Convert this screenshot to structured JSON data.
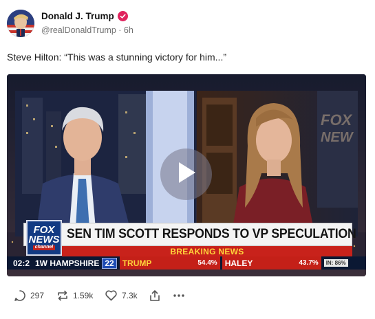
{
  "post": {
    "display_name": "Donald J. Trump",
    "handle_time": "@realDonaldTrump · 6h",
    "text": "Steve Hilton: “This was a stunning victory for him...”"
  },
  "video": {
    "fox_logo": {
      "line1": "FOX",
      "line2": "NEWS",
      "line3": "channel"
    },
    "chyron": "SEN TIM SCOTT RESPONDS TO VP SPECULATION",
    "breaking": "BREAKING NEWS",
    "ticker": {
      "time": "02:2",
      "state": "1W HAMPSHIRE",
      "pct_reported": "22",
      "trump_name": "TRUMP",
      "trump_pct": "54.4%",
      "haley_name": "HALEY",
      "haley_pct": "43.7%",
      "in_label": "IN: 86%"
    },
    "studio_sign": "FOX NEWS"
  },
  "actions": {
    "replies": "297",
    "reposts": "1.59k",
    "likes": "7.3k"
  },
  "colors": {
    "verified": "#e0245e",
    "fox_blue": "#123a83",
    "breaking_red": "#c8221b",
    "ticker_navy": "#0b1833"
  },
  "icons": [
    "verified-badge-icon",
    "play-icon",
    "reply-icon",
    "repost-icon",
    "like-icon",
    "share-icon",
    "more-icon"
  ]
}
